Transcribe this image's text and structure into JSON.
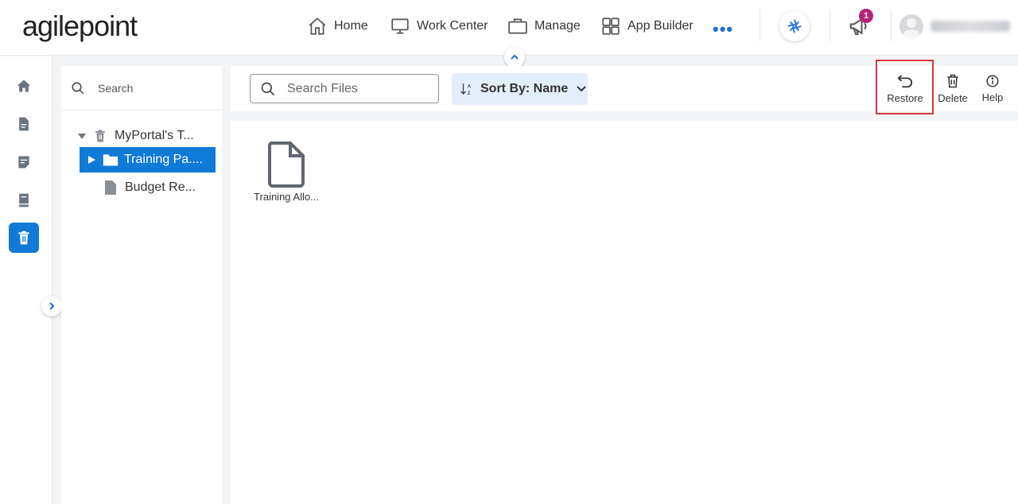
{
  "header": {
    "logo_text": "agilepoint",
    "nav": [
      {
        "label": "Home",
        "icon": "home-icon"
      },
      {
        "label": "Work Center",
        "icon": "monitor-icon"
      },
      {
        "label": "Manage",
        "icon": "briefcase-icon"
      },
      {
        "label": "App Builder",
        "icon": "grid-icon"
      }
    ],
    "more_label": "•••",
    "notification_count": "1"
  },
  "rail": {
    "items": [
      "home-icon",
      "document-icon",
      "form-icon",
      "book-icon",
      "trash-icon"
    ],
    "active_index": 4
  },
  "tree": {
    "search_placeholder": "Search",
    "nodes": [
      {
        "label": "MyPortal's T...",
        "icon": "trash-icon"
      },
      {
        "label": "Training Pa....",
        "icon": "folder-icon",
        "selected": true
      },
      {
        "label": "Budget Re...",
        "icon": "file-icon"
      }
    ]
  },
  "toolbar": {
    "search_placeholder": "Search Files",
    "sort_label": "Sort By: Name",
    "actions": [
      {
        "label": "Restore",
        "icon": "undo-icon"
      },
      {
        "label": "Delete",
        "icon": "trash-icon"
      },
      {
        "label": "Help",
        "icon": "info-icon"
      }
    ]
  },
  "content": {
    "files": [
      {
        "label": "Training Allo..."
      }
    ]
  },
  "colors": {
    "accent": "#1279d6",
    "badge": "#b4237a",
    "highlight_border": "#d9363e"
  }
}
